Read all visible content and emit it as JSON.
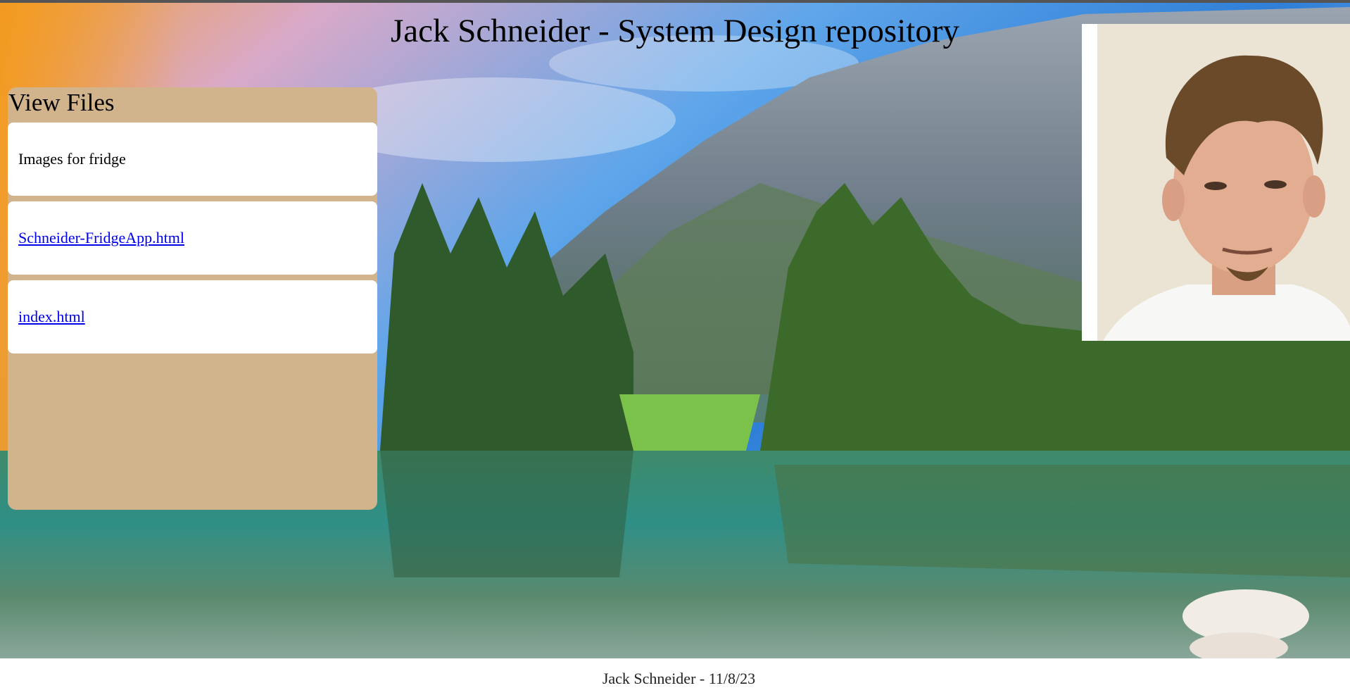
{
  "header": {
    "title": "Jack Schneider - System Design repository"
  },
  "files_panel": {
    "heading": "View Files",
    "items": [
      {
        "label": "Images for fridge",
        "is_link": false
      },
      {
        "label": "Schneider-FridgeApp.html",
        "is_link": true
      },
      {
        "label": "index.html",
        "is_link": true
      }
    ]
  },
  "portrait": {
    "description_icon": "profile-photo"
  },
  "footer": {
    "text": "Jack Schneider - 11/8/23"
  },
  "colors": {
    "panel_bg": "#d2b48c",
    "card_bg": "#ffffff",
    "link": "#0000ee"
  }
}
